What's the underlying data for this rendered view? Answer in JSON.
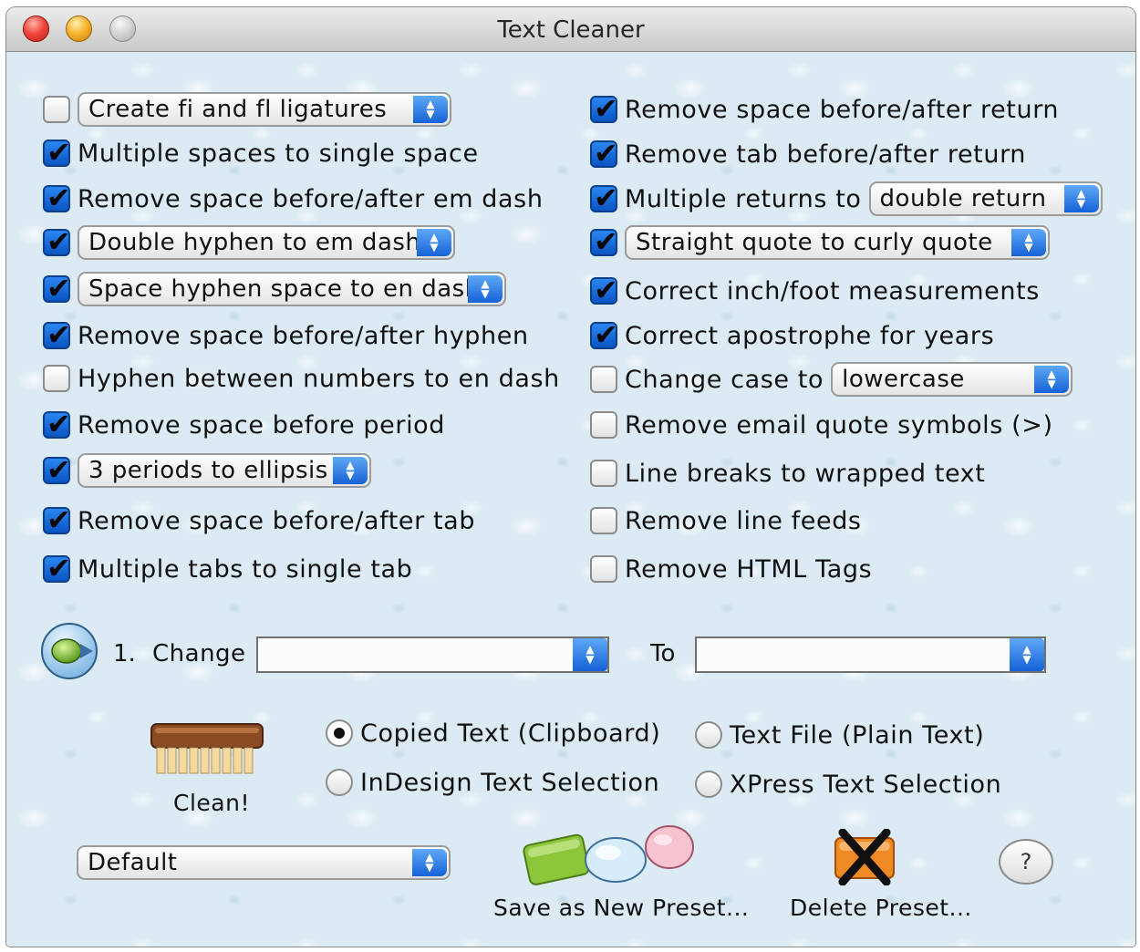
{
  "window": {
    "title": "Text Cleaner"
  },
  "left_options": [
    {
      "checked": false,
      "popup": "Create fi and fl ligatures"
    },
    {
      "checked": true,
      "label": "Multiple spaces to single space"
    },
    {
      "checked": true,
      "label": "Remove space before/after em dash"
    },
    {
      "checked": true,
      "popup": "Double hyphen to em dash"
    },
    {
      "checked": true,
      "popup": "Space hyphen space to en dash"
    },
    {
      "checked": true,
      "label": "Remove space before/after hyphen"
    },
    {
      "checked": false,
      "label": "Hyphen between numbers to en dash"
    },
    {
      "checked": true,
      "label": "Remove space before period"
    },
    {
      "checked": true,
      "popup": "3 periods to ellipsis"
    },
    {
      "checked": true,
      "label": "Remove space before/after tab"
    },
    {
      "checked": true,
      "label": "Multiple tabs to single tab"
    }
  ],
  "right_options": [
    {
      "checked": true,
      "label": "Remove space before/after return"
    },
    {
      "checked": true,
      "label": "Remove tab before/after return"
    },
    {
      "checked": true,
      "label": "Multiple returns to",
      "popup": "double return"
    },
    {
      "checked": true,
      "popup": "Straight quote to curly quote"
    },
    {
      "checked": true,
      "label": "Correct inch/foot measurements"
    },
    {
      "checked": true,
      "label": "Correct apostrophe for years"
    },
    {
      "checked": false,
      "label": "Change case to",
      "popup": "lowercase"
    },
    {
      "checked": false,
      "label": "Remove email quote symbols (>)"
    },
    {
      "checked": false,
      "label": "Line breaks to wrapped text"
    },
    {
      "checked": false,
      "label": "Remove line feeds"
    },
    {
      "checked": false,
      "label": "Remove HTML Tags"
    }
  ],
  "change": {
    "index": "1.",
    "label": "Change",
    "from_value": "",
    "to_label": "To",
    "to_value": ""
  },
  "clean": {
    "label": "Clean!"
  },
  "sources": [
    {
      "label": "Copied Text (Clipboard)",
      "selected": true
    },
    {
      "label": "Text File (Plain Text)",
      "selected": false
    },
    {
      "label": "InDesign Text Selection",
      "selected": false
    },
    {
      "label": "XPress Text Selection",
      "selected": false
    }
  ],
  "preset": {
    "value": "Default",
    "save_label": "Save as New Preset...",
    "delete_label": "Delete Preset...",
    "help_label": "?"
  },
  "colors": {
    "accent": "#1a6fe0",
    "background": "#dbeaf3"
  }
}
